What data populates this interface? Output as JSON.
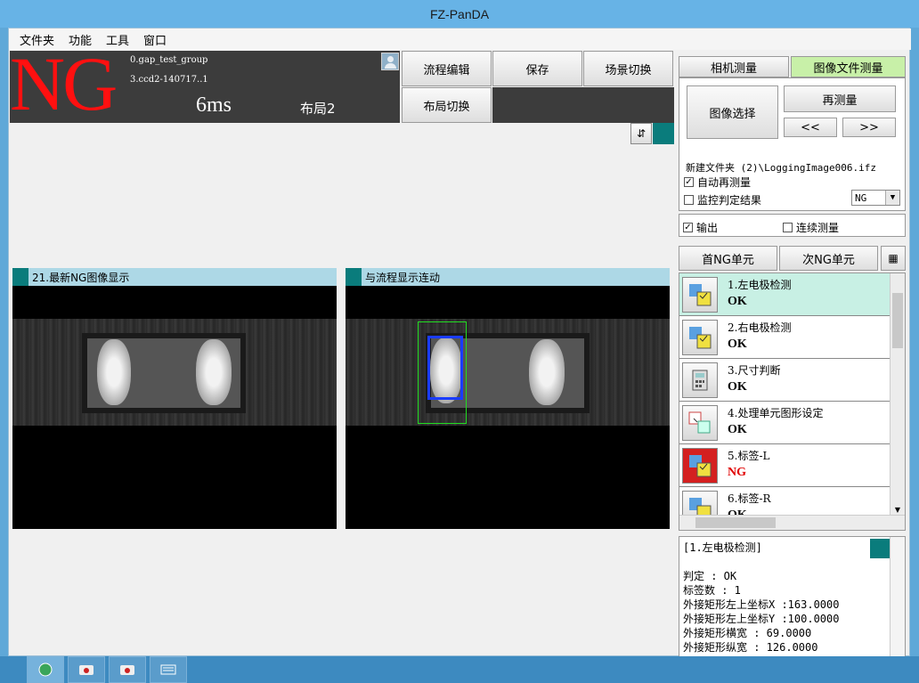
{
  "window": {
    "title": "FZ-PanDA"
  },
  "menu": [
    "文件夹",
    "功能",
    "工具",
    "窗口"
  ],
  "status": {
    "judgement": "NG",
    "scene_group": "0.gap_test_group",
    "scene": "3.ccd2-140717..1",
    "time": "6ms",
    "layout": "布局2"
  },
  "toolbar": {
    "flow_edit": "流程编辑",
    "save": "保存",
    "scene_switch": "场景切换",
    "layout_switch": "布局切换"
  },
  "panels": {
    "left_title": "21.最新NG图像显示",
    "right_title": "与流程显示连动"
  },
  "tabs": {
    "camera": "相机测量",
    "image_file": "图像文件测量"
  },
  "image_file": {
    "select": "图像选择",
    "remeasure": "再测量",
    "prev": "<<",
    "next": ">>",
    "path": "新建文件夹 (2)\\LoggingImage006.ifz",
    "auto_remeasure": "自动再测量",
    "monitor": "监控判定结果",
    "monitor_value": "NG"
  },
  "output": {
    "output_label": "输出",
    "continuous_label": "连续测量"
  },
  "nav": {
    "first_ng": "首NG单元",
    "next_ng": "次NG单元"
  },
  "units": [
    {
      "name": "1.左电极检测",
      "result": "OK"
    },
    {
      "name": "2.右电极检测",
      "result": "OK"
    },
    {
      "name": "3.尺寸判断",
      "result": "OK"
    },
    {
      "name": "4.处理单元图形设定",
      "result": "OK"
    },
    {
      "name": "5.标签-L",
      "result": "NG"
    },
    {
      "name": "6.标签-R",
      "result": "OK"
    }
  ],
  "detail": {
    "title": "[1.左电极检测]",
    "lines": [
      "判定 : OK",
      "标签数 : 1",
      "外接矩形左上坐标X :163.0000",
      "外接矩形左上坐标Y :100.0000",
      "外接矩形横宽 : 69.0000",
      "外接矩形纵宽 : 126.0000"
    ]
  },
  "colors": {
    "ng": "#ff1010",
    "ok": "#000000",
    "accent": "#0a7c7c",
    "selected_tab": "#c8f0a8"
  }
}
